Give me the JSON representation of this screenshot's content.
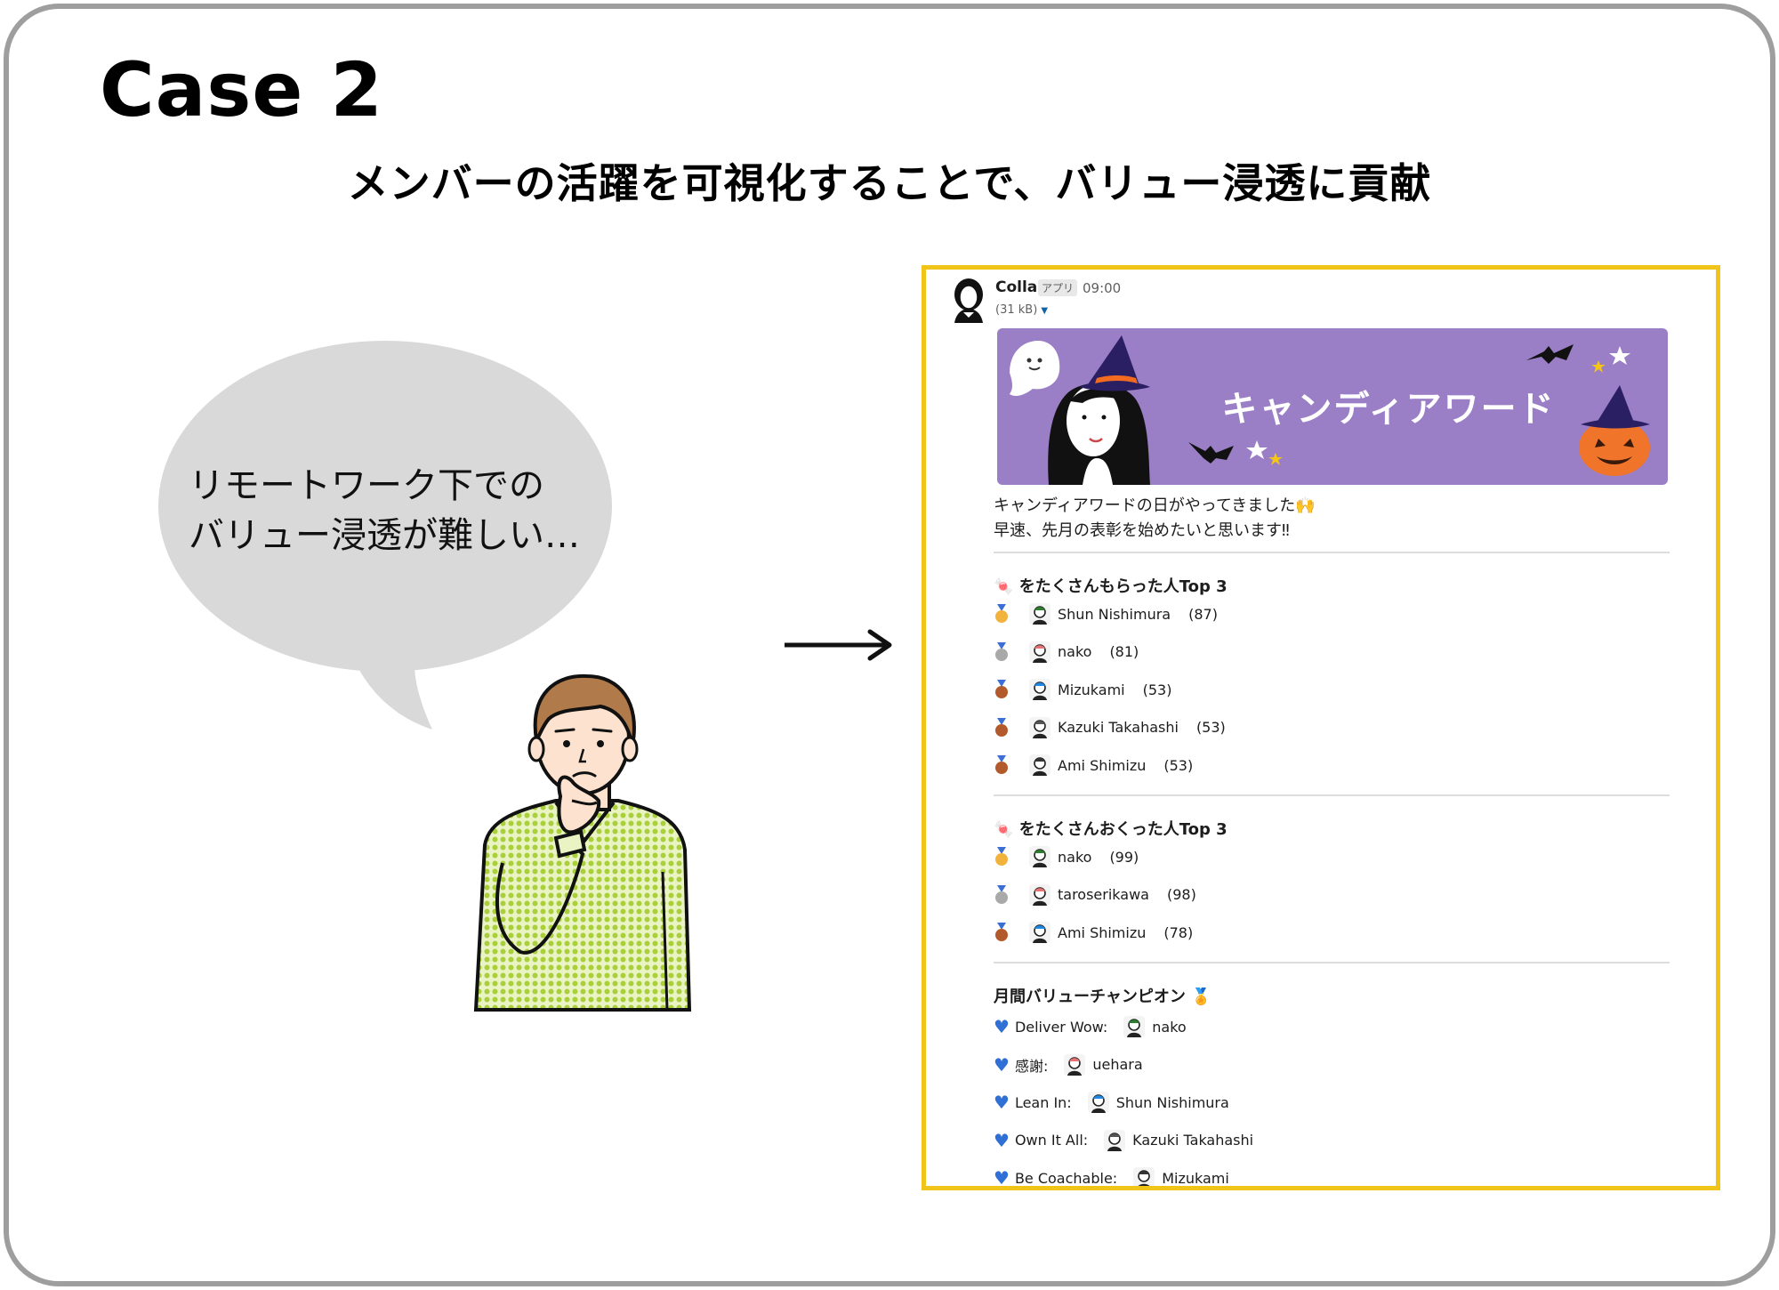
{
  "header": {
    "case_title": "Case 2",
    "subtitle": "メンバーの活躍を可視化することで、バリュー浸透に貢献"
  },
  "bubble": {
    "line1": "リモートワーク下での",
    "line2": "バリュー浸透が難しい…"
  },
  "message": {
    "sender": "Colla",
    "badge": "アプリ",
    "time": "09:00",
    "filesize": "(31 kB)",
    "banner_title": "キャンディアワード",
    "intro_line1": "キャンディアワードの日がやってきました🙌",
    "intro_line2": "早速、先月の表彰を始めたいと思います‼"
  },
  "received": {
    "title": "をたくさんもらった人Top 3",
    "rows": [
      {
        "name": "Shun Nishimura",
        "count": "(87)"
      },
      {
        "name": "nako",
        "count": "(81)"
      },
      {
        "name": "Mizukami",
        "count": "(53)"
      },
      {
        "name": "Kazuki Takahashi",
        "count": "(53)"
      },
      {
        "name": "Ami Shimizu",
        "count": "(53)"
      }
    ]
  },
  "sent": {
    "title": "をたくさんおくった人Top 3",
    "rows": [
      {
        "name": "nako",
        "count": "(99)"
      },
      {
        "name": "taroserikawa",
        "count": "(98)"
      },
      {
        "name": "Ami Shimizu",
        "count": "(78)"
      }
    ]
  },
  "champions": {
    "title": "月間バリューチャンピオン",
    "rows": [
      {
        "value": "Deliver Wow:",
        "name": "nako"
      },
      {
        "value": "感謝:",
        "name": "uehara"
      },
      {
        "value": "Lean In:",
        "name": "Shun Nishimura"
      },
      {
        "value": "Own It All:",
        "name": "Kazuki Takahashi"
      },
      {
        "value": "Be Coachable:",
        "name": "Mizukami"
      }
    ]
  },
  "colors": {
    "panel_border": "#f0c419",
    "banner_bg": "#9a7ec6",
    "bubble_bg": "#d9d9d9",
    "heart": "#2f6fd6",
    "gold": "#f2b33d",
    "silver": "#a9a9a9",
    "bronze": "#b35a2d"
  }
}
